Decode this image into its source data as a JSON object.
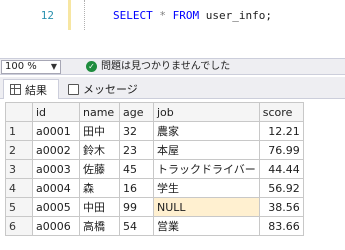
{
  "editor": {
    "line_number": "12",
    "code_keyword_select": "SELECT",
    "code_star": "*",
    "code_keyword_from": "FROM",
    "code_table": "user_info;"
  },
  "statusbar": {
    "zoom_value": "100 %",
    "status_message": "問題は見つかりませんでした"
  },
  "tabs": [
    {
      "label": "結果",
      "icon": "grid-icon"
    },
    {
      "label": "メッセージ",
      "icon": "message-icon"
    }
  ],
  "results": {
    "columns": [
      "id",
      "name",
      "age",
      "job",
      "score"
    ],
    "rows": [
      {
        "n": "1",
        "id": "a0001",
        "name": "田中",
        "age": "32",
        "job": "農家",
        "score": "12.21"
      },
      {
        "n": "2",
        "id": "a0002",
        "name": "鈴木",
        "age": "23",
        "job": "本屋",
        "score": "76.99"
      },
      {
        "n": "3",
        "id": "a0003",
        "name": "佐藤",
        "age": "45",
        "job": "トラックドライバー",
        "score": "44.44"
      },
      {
        "n": "4",
        "id": "a0004",
        "name": "森",
        "age": "16",
        "job": "学生",
        "score": "56.92"
      },
      {
        "n": "5",
        "id": "a0005",
        "name": "中田",
        "age": "99",
        "job": "NULL",
        "score": "38.56"
      },
      {
        "n": "6",
        "id": "a0006",
        "name": "高橋",
        "age": "54",
        "job": "営業",
        "score": "83.66"
      }
    ]
  },
  "colors": {
    "keyword": "#0000ff",
    "line_number": "#2b91af",
    "null_highlight": "#fff0d0",
    "ok_icon": "#1e8c3e"
  }
}
